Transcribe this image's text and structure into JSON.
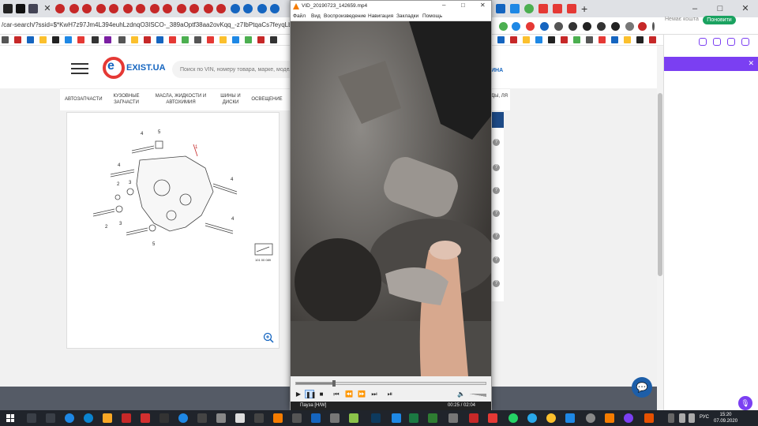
{
  "browser": {
    "url": "/car-search/?ssid=$*KwH7z97Jm4L394euhLzdnqO3ISCO-_389aOptf38aa2ovKqq_-z7IbPtqaCs7feyqLbr5O29rqGr76q8svnq",
    "new_tab": "+",
    "save_hint": "Немає кошта",
    "update_label": "Поновити",
    "window_controls": [
      "–",
      "□",
      "✕"
    ]
  },
  "site": {
    "logo_text": "EXIST.UA",
    "logo_letter": "e",
    "search_placeholder": "Поиск по VIN, номеру товара, марке, модел",
    "cart_label": "ИНА",
    "nav": [
      "АВТОЗАПЧАСТИ",
      "КУЗОВНЫЕ ЗАПЧАСТИ",
      "МАСЛА, ЖИДКОСТИ И АВТОХИМИЯ",
      "ШИНЫ И ДИСКИ",
      "ОСВЕЩЕНИЕ"
    ],
    "nav_right": "ДЫ, ЛЯ",
    "diagram_labels": [
      "4",
      "5",
      "1",
      "4",
      "2",
      "3",
      "4",
      "2",
      "3",
      "4",
      "5"
    ],
    "diagram_code": "101 00 089",
    "result_marks": [
      "?",
      "?",
      "?",
      "?",
      "?",
      "?",
      "?"
    ]
  },
  "player": {
    "title": "VID_20190723_142659.mp4",
    "menu": [
      "Файл",
      "Вид",
      "Воспроизведение",
      "Навигация",
      "Закладки",
      "Помощь"
    ],
    "status_left": "Пауза [H/W]",
    "status_time": "00:25 / 02:04",
    "progress": 0.2
  },
  "taskbar": {
    "language": "РУС",
    "time": "15:20",
    "date": "07.09.2020"
  },
  "colors": {
    "brand_blue": "#1565c0",
    "brand_red": "#e53935",
    "accent_purple": "#7b3ff2",
    "update_green": "#1aa260"
  }
}
